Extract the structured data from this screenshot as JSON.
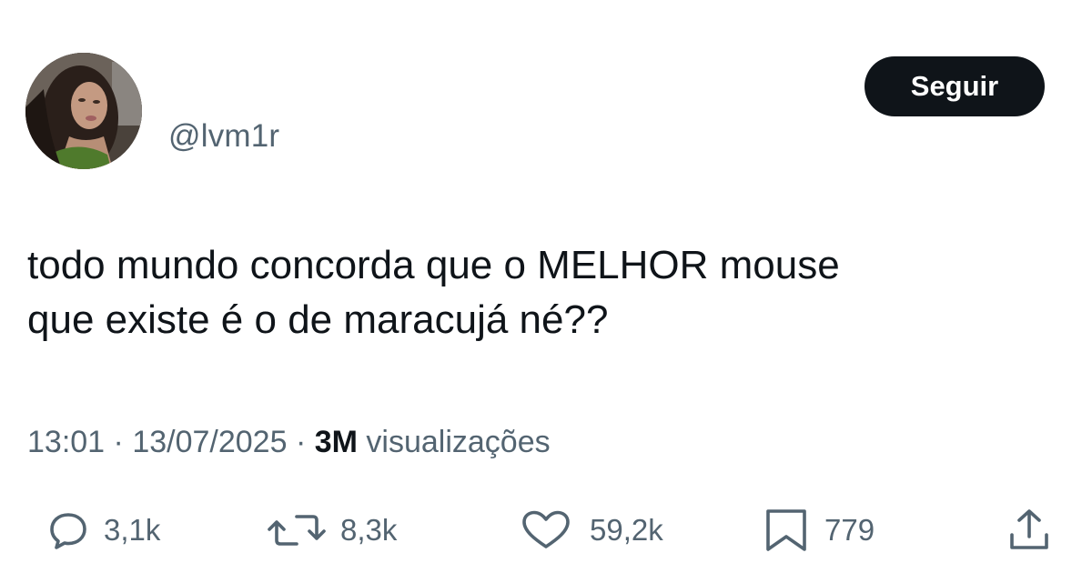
{
  "user": {
    "handle": "@lvm1r",
    "avatar_icon": "profile-photo"
  },
  "follow_button": {
    "label": "Seguir"
  },
  "tweet": {
    "lines": [
      "todo mundo concorda que o MELHOR mouse",
      "que existe é o de maracujá né??"
    ]
  },
  "meta": {
    "time": "13:01",
    "separator": "·",
    "date": "13/07/2025",
    "views_count": "3M",
    "views_label": "visualizações"
  },
  "actions": {
    "replies": {
      "icon": "reply-icon",
      "count": "3,1k"
    },
    "retweets": {
      "icon": "retweet-icon",
      "count": "8,3k"
    },
    "likes": {
      "icon": "heart-icon",
      "count": "59,2k"
    },
    "bookmarks": {
      "icon": "bookmark-icon",
      "count": "779"
    },
    "share": {
      "icon": "share-icon"
    }
  },
  "colors": {
    "text_primary": "#0f1419",
    "text_secondary": "#536471",
    "button_bg": "#0f1419",
    "button_text": "#ffffff",
    "background": "#ffffff"
  }
}
